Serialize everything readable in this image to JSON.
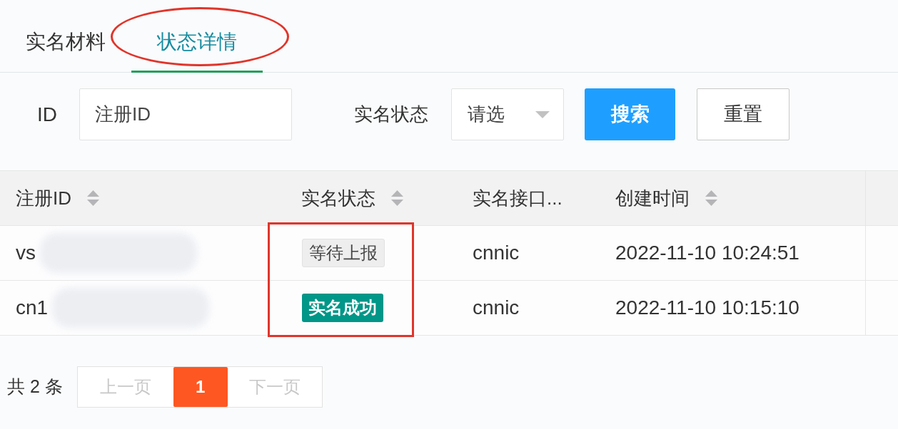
{
  "tabs": [
    {
      "label": "实名材料",
      "selected": false
    },
    {
      "label": "状态详情",
      "selected": true
    }
  ],
  "filters": {
    "id_label": "ID",
    "id_field": {
      "placeholder": "注册ID"
    },
    "status_label": "实名状态",
    "status_select": {
      "placeholder": "请选"
    },
    "buttons": [
      {
        "label": "搜索",
        "kind": "primary"
      },
      {
        "label": "重置",
        "kind": "default"
      }
    ]
  },
  "table": {
    "columns": [
      {
        "label": "注册ID",
        "sortable": true
      },
      {
        "label": "实名状态",
        "sortable": true
      },
      {
        "label": "实名接口...",
        "sortable": false
      },
      {
        "label": "创建时间",
        "sortable": true
      }
    ],
    "rows": [
      {
        "id": "vs",
        "redacted": true,
        "status": {
          "label": "等待上报",
          "kind": "pending"
        },
        "interface": "cnnic",
        "created": "2022-11-10 10:24:51"
      },
      {
        "id": "cn1",
        "redacted": true,
        "status": {
          "label": "实名成功",
          "kind": "success"
        },
        "interface": "cnnic",
        "created": "2022-11-10 10:15:10"
      }
    ]
  },
  "pagination": {
    "total": "共 2 条",
    "pages": [
      {
        "label": "上一页",
        "kind": "prev",
        "selected": false,
        "disabled": true
      },
      {
        "label": "1",
        "kind": "page",
        "selected": true
      },
      {
        "label": "下一页",
        "kind": "next",
        "selected": false,
        "disabled": true
      }
    ]
  },
  "annotations": [
    {
      "kind": "ellipse"
    },
    {
      "kind": "rectangle"
    }
  ]
}
